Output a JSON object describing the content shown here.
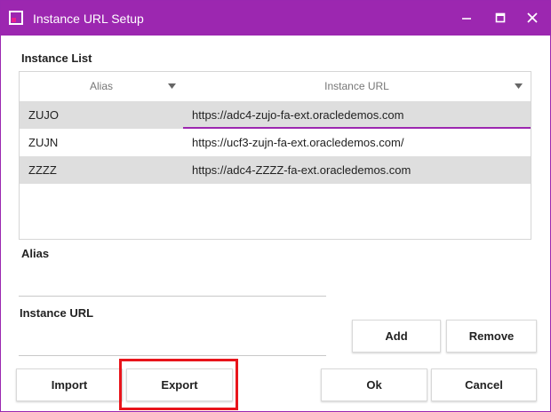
{
  "window": {
    "title": "Instance URL Setup",
    "accent_color": "#9c27b0",
    "controls": [
      "minimize-icon",
      "maximize-icon",
      "close-icon"
    ]
  },
  "instance_list": {
    "label": "Instance List",
    "columns": [
      {
        "header": "Alias"
      },
      {
        "header": "Instance URL"
      }
    ],
    "rows": [
      {
        "alias": "ZUJO",
        "url": "https://adc4-zujo-fa-ext.oracledemos.com"
      },
      {
        "alias": "ZUJN",
        "url": "https://ucf3-zujn-fa-ext.oracledemos.com/"
      },
      {
        "alias": "ZZZZ",
        "url": "https://adc4-ZZZZ-fa-ext.oracledemos.com"
      }
    ]
  },
  "form": {
    "alias_label": "Alias",
    "alias_value": "",
    "url_label": "Instance URL",
    "url_value": ""
  },
  "buttons": {
    "add": "Add",
    "remove": "Remove",
    "import": "Import",
    "export": "Export",
    "ok": "Ok",
    "cancel": "Cancel"
  }
}
